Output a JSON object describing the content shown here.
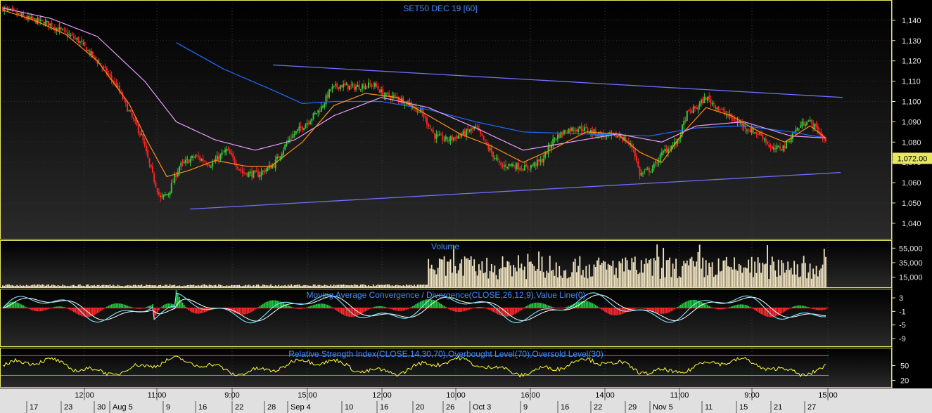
{
  "chart_data": [
    {
      "type": "candlestick",
      "title": "SET50 DEC 19   [60]",
      "ylim": [
        1032,
        1150
      ],
      "yticks": [
        "1,140",
        "1,130",
        "1,120",
        "1,110",
        "1,100",
        "1,090",
        "1,080",
        "1,070",
        "1,060",
        "1,050",
        "1,040"
      ],
      "last_price_label": "1,072.00",
      "last_price": 1072,
      "close_path": [
        [
          0,
          1146
        ],
        [
          15,
          1141
        ],
        [
          30,
          1138
        ],
        [
          48,
          1130
        ],
        [
          62,
          1118
        ],
        [
          72,
          1108
        ],
        [
          80,
          1095
        ],
        [
          88,
          1083
        ],
        [
          94,
          1066
        ],
        [
          100,
          1052
        ],
        [
          105,
          1055
        ],
        [
          112,
          1068
        ],
        [
          122,
          1073
        ],
        [
          132,
          1069
        ],
        [
          142,
          1076
        ],
        [
          152,
          1065
        ],
        [
          162,
          1064
        ],
        [
          172,
          1069
        ],
        [
          182,
          1082
        ],
        [
          192,
          1089
        ],
        [
          202,
          1097
        ],
        [
          208,
          1106
        ],
        [
          214,
          1108
        ],
        [
          222,
          1107
        ],
        [
          230,
          1108
        ],
        [
          236,
          1108
        ],
        [
          242,
          1103
        ],
        [
          250,
          1102
        ],
        [
          258,
          1099
        ],
        [
          266,
          1094
        ],
        [
          274,
          1083
        ],
        [
          282,
          1081
        ],
        [
          292,
          1084
        ],
        [
          300,
          1087
        ],
        [
          308,
          1077
        ],
        [
          316,
          1068
        ],
        [
          322,
          1069
        ],
        [
          332,
          1067
        ],
        [
          342,
          1071
        ],
        [
          350,
          1082
        ],
        [
          358,
          1086
        ],
        [
          366,
          1087
        ],
        [
          374,
          1085
        ],
        [
          382,
          1083
        ],
        [
          392,
          1083
        ],
        [
          400,
          1077
        ],
        [
          404,
          1064
        ],
        [
          412,
          1067
        ],
        [
          420,
          1076
        ],
        [
          428,
          1080
        ],
        [
          434,
          1094
        ],
        [
          440,
          1097
        ],
        [
          446,
          1102
        ],
        [
          452,
          1098
        ],
        [
          458,
          1094
        ],
        [
          466,
          1090
        ],
        [
          474,
          1086
        ],
        [
          482,
          1083
        ],
        [
          488,
          1076
        ],
        [
          496,
          1078
        ],
        [
          502,
          1085
        ],
        [
          510,
          1091
        ],
        [
          516,
          1087
        ],
        [
          522,
          1080
        ]
      ],
      "trend_upper": [
        [
          388,
          1118
        ],
        [
          1198,
          1102
        ]
      ],
      "trend_lower": [
        [
          270,
          1047
        ],
        [
          1195,
          1065
        ]
      ],
      "ma_fast_color": "#ff8c1a",
      "ma_mid_color": "#e89cff",
      "ma_slow_color": "#1e6bff",
      "ma_fast_path": [
        [
          0,
          1145
        ],
        [
          20,
          1140
        ],
        [
          40,
          1133
        ],
        [
          60,
          1120
        ],
        [
          80,
          1099
        ],
        [
          92,
          1080
        ],
        [
          104,
          1063
        ],
        [
          118,
          1066
        ],
        [
          135,
          1071
        ],
        [
          155,
          1068
        ],
        [
          170,
          1068
        ],
        [
          190,
          1080
        ],
        [
          210,
          1098
        ],
        [
          230,
          1104
        ],
        [
          250,
          1102
        ],
        [
          270,
          1093
        ],
        [
          290,
          1084
        ],
        [
          310,
          1078
        ],
        [
          330,
          1070
        ],
        [
          350,
          1077
        ],
        [
          370,
          1085
        ],
        [
          390,
          1084
        ],
        [
          404,
          1075
        ],
        [
          418,
          1070
        ],
        [
          432,
          1085
        ],
        [
          446,
          1097
        ],
        [
          462,
          1093
        ],
        [
          480,
          1085
        ],
        [
          496,
          1080
        ],
        [
          512,
          1088
        ],
        [
          522,
          1082
        ]
      ],
      "ma_mid_path": [
        [
          0,
          1146
        ],
        [
          30,
          1141
        ],
        [
          60,
          1132
        ],
        [
          90,
          1110
        ],
        [
          110,
          1090
        ],
        [
          135,
          1081
        ],
        [
          160,
          1076
        ],
        [
          185,
          1081
        ],
        [
          210,
          1093
        ],
        [
          240,
          1102
        ],
        [
          270,
          1097
        ],
        [
          300,
          1087
        ],
        [
          330,
          1076
        ],
        [
          360,
          1080
        ],
        [
          390,
          1084
        ],
        [
          418,
          1080
        ],
        [
          440,
          1088
        ],
        [
          470,
          1090
        ],
        [
          500,
          1083
        ],
        [
          522,
          1082
        ]
      ],
      "ma_slow_path": [
        [
          110,
          1129
        ],
        [
          140,
          1116
        ],
        [
          170,
          1106
        ],
        [
          190,
          1099
        ],
        [
          210,
          1100
        ],
        [
          240,
          1100
        ],
        [
          270,
          1096
        ],
        [
          300,
          1090
        ],
        [
          330,
          1085
        ],
        [
          370,
          1084
        ],
        [
          410,
          1083
        ],
        [
          440,
          1087
        ],
        [
          470,
          1088
        ],
        [
          500,
          1085
        ],
        [
          522,
          1082
        ]
      ]
    },
    {
      "type": "bar",
      "title": "Volume",
      "yticks": [
        "55,000",
        "35,000",
        "15,000"
      ],
      "color": "#f3e6c3"
    },
    {
      "type": "line",
      "title": "Moving Average Convergence / Divergence(CLOSE,26,12,9),Value Line(0)",
      "yticks": [
        "3",
        "-1",
        "-5",
        "-9"
      ],
      "macd_color": "#7fe7ff",
      "signal_color": "#ffffff",
      "hist_pos_color": "#22cc44",
      "hist_neg_color": "#ff2a2a"
    },
    {
      "type": "line",
      "title": "Relative Strength Index(CLOSE,14,30,70),Overbought Level(70),Oversold Level(30)",
      "yticks": [
        "50",
        "20"
      ],
      "rsi_color": "#ffff33",
      "overbought_color": "#ff2a6a",
      "oversold_color": "#22cc44"
    }
  ],
  "time_labels": [
    "12:00",
    "11:00",
    "9:00",
    "15:00",
    "12:00",
    "10:00",
    "16:00",
    "14:00",
    "11:00",
    "9:00",
    "15:00"
  ],
  "date_labels": [
    "17",
    "23",
    "30",
    "Aug 5",
    "9",
    "16",
    "22",
    "28",
    "Sep 4",
    "10",
    "16",
    "20",
    "26",
    "Oct 3",
    "9",
    "16",
    "22",
    "29",
    "Nov 5",
    "11",
    "15",
    "21",
    "27"
  ]
}
